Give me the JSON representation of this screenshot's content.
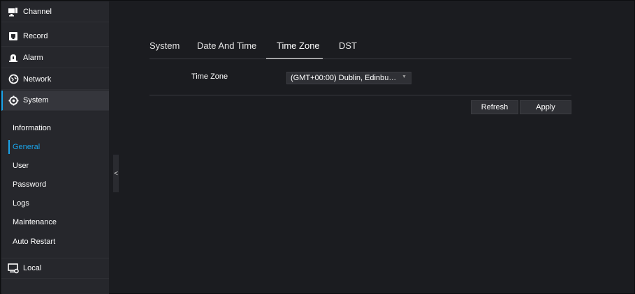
{
  "sidebar": {
    "top_items": [
      {
        "label": "Channel",
        "icon": "channel-icon"
      },
      {
        "label": "Record",
        "icon": "record-icon"
      },
      {
        "label": "Alarm",
        "icon": "alarm-icon"
      },
      {
        "label": "Network",
        "icon": "network-icon"
      },
      {
        "label": "System",
        "icon": "system-gear-icon",
        "active": true
      }
    ],
    "sub_items": [
      {
        "label": "Information"
      },
      {
        "label": "General",
        "active": true
      },
      {
        "label": "User"
      },
      {
        "label": "Password"
      },
      {
        "label": "Logs"
      },
      {
        "label": "Maintenance"
      },
      {
        "label": "Auto Restart"
      }
    ],
    "bottom_item": {
      "label": "Local",
      "icon": "local-icon"
    },
    "collapse_glyph": "<"
  },
  "tabs": [
    {
      "label": "System"
    },
    {
      "label": "Date And Time"
    },
    {
      "label": "Time Zone",
      "active": true
    },
    {
      "label": "DST"
    }
  ],
  "time_zone": {
    "label": "Time Zone",
    "value": "(GMT+00:00) Dublin, Edinbu…",
    "caret": "▼"
  },
  "actions": {
    "refresh_label": "Refresh",
    "apply_label": "Apply"
  },
  "colors": {
    "accent": "#1aa3e8",
    "background": "#1b1c20",
    "sidebar": "#26272c"
  }
}
